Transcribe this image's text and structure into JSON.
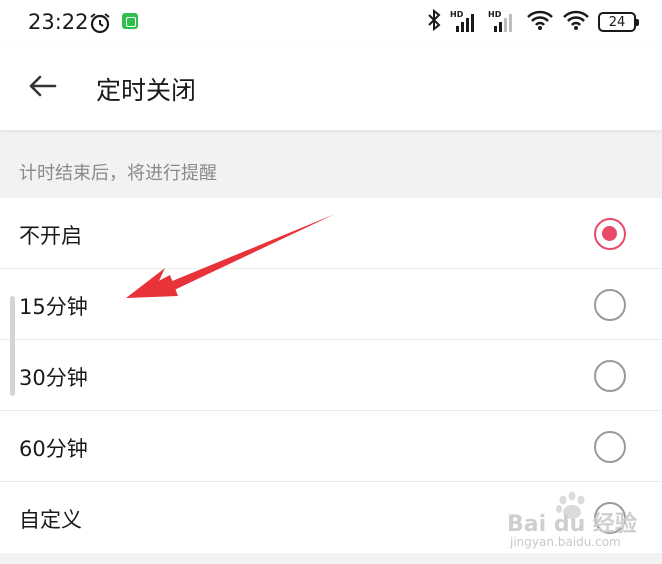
{
  "status_bar": {
    "time": "23:22",
    "battery": "24",
    "icons": [
      "alarm-clock-icon",
      "app-badge-icon",
      "bluetooth-icon",
      "hd-signal-icon",
      "hd-signal-icon",
      "wifi-icon",
      "wifi-icon",
      "battery-icon"
    ],
    "hd_label": "HD"
  },
  "header": {
    "back_icon": "arrow-left-icon",
    "title": "定时关闭"
  },
  "section_hint": "计时结束后，将进行提醒",
  "options": [
    {
      "label": "不开启",
      "selected": true
    },
    {
      "label": "15分钟",
      "selected": false
    },
    {
      "label": "30分钟",
      "selected": false
    },
    {
      "label": "60分钟",
      "selected": false
    },
    {
      "label": "自定义",
      "selected": false
    }
  ],
  "colors": {
    "accent": "#e84a6a",
    "annotation_arrow": "#e8333a",
    "background": "#f2f2f2"
  },
  "watermark": {
    "brand": "Bai du 经验",
    "url": "jingyan.baidu.com"
  }
}
